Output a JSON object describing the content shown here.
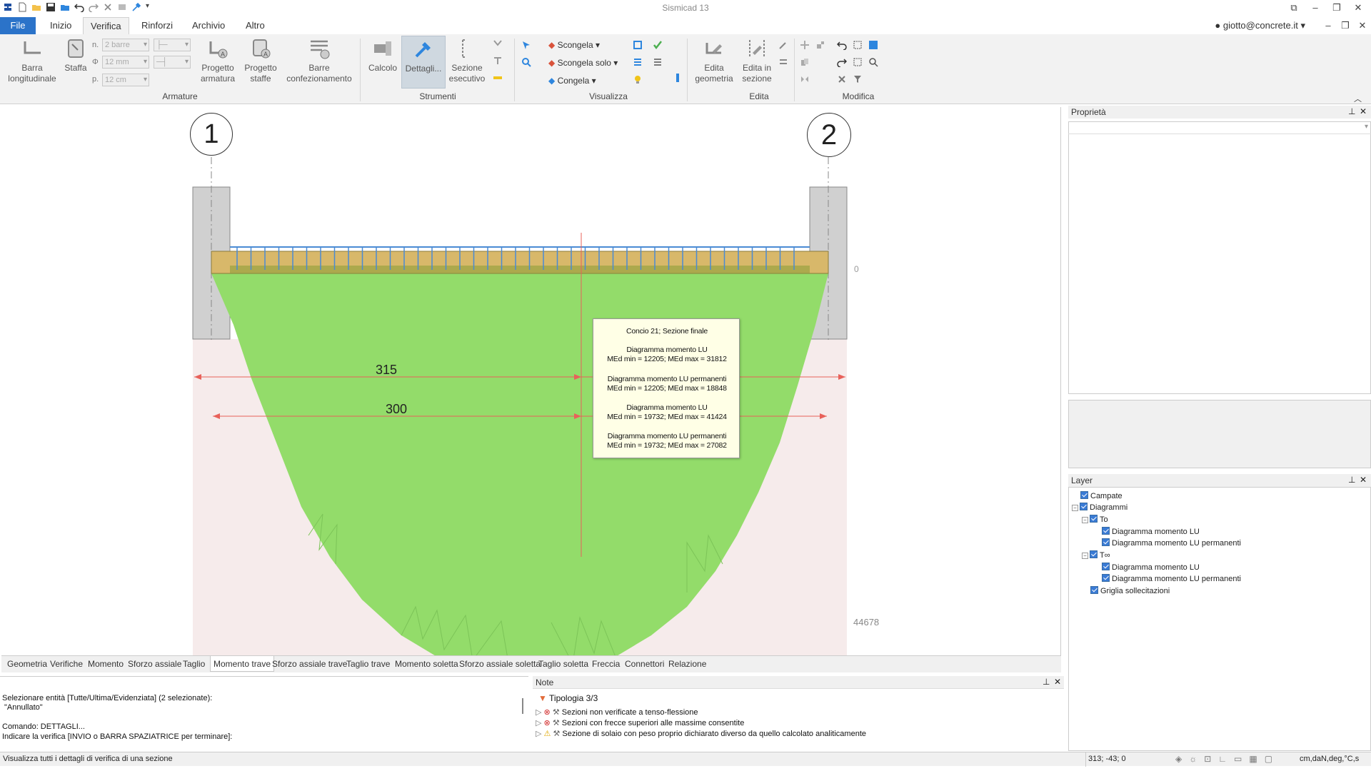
{
  "app": {
    "title": "Sismicad 13",
    "user": "giotto@concrete.it"
  },
  "ribbon_tabs": [
    "File",
    "Inizio",
    "Verifica",
    "Rinforzi",
    "Archivio",
    "Altro"
  ],
  "ribbon": {
    "armature": {
      "group": "Armature",
      "barra_line1": "Barra",
      "barra_line2": "longitudinale",
      "staffa": "Staffa",
      "n_label": "n.",
      "n_value": "2 barre",
      "phi_label": "Φ",
      "phi_value": "12 mm",
      "p_label": "p.",
      "p_value": "12 cm",
      "progetto_arm_1": "Progetto",
      "progetto_arm_2": "armatura",
      "progetto_staffe_1": "Progetto",
      "progetto_staffe_2": "staffe",
      "barre_conf_1": "Barre",
      "barre_conf_2": "confezionamento"
    },
    "strumenti": {
      "group": "Strumenti",
      "calcolo": "Calcolo",
      "dettagli": "Dettagli...",
      "sezione_1": "Sezione",
      "sezione_2": "esecutivo"
    },
    "visualizza": {
      "group": "Visualizza",
      "scongela": "Scongela",
      "scongela_solo": "Scongela solo",
      "congela": "Congela"
    },
    "edita": {
      "group": "Edita",
      "edita_geom_1": "Edita",
      "edita_geom_2": "geometria",
      "edita_sez_1": "Edita in",
      "edita_sez_2": "sezione"
    },
    "modifica": {
      "group": "Modifica"
    }
  },
  "drawing": {
    "axis1": "1",
    "axis2": "2",
    "zero_label": "0",
    "dim_315": "315",
    "dim_300": "300",
    "max_label": "44678",
    "tooltip": {
      "title": "Concio 21; Sezione finale",
      "b1_name": "Diagramma momento LU",
      "b1_vals": "MEd min = 12205; MEd max = 31812",
      "b2_name": "Diagramma momento LU permanenti",
      "b2_vals": "MEd min = 12205; MEd max = 18848",
      "b3_name": "Diagramma momento LU",
      "b3_vals": "MEd min = 19732; MEd max = 41424",
      "b4_name": "Diagramma momento LU permanenti",
      "b4_vals": "MEd min = 19732; MEd max = 27082"
    },
    "colors": {
      "diagram": "#93dc6a",
      "slab": "#d8b86a",
      "support": "#c8c8c8",
      "dim": "#e8615a"
    }
  },
  "panels": {
    "properties_title": "Proprietà",
    "layer_title": "Layer",
    "layers": {
      "campate": "Campate",
      "diagrammi": "Diagrammi",
      "to": "To",
      "to_lu": "Diagramma momento LU",
      "to_lup": "Diagramma momento LU permanenti",
      "tinf": "T∞",
      "tinf_lu": "Diagramma momento LU",
      "tinf_lup": "Diagramma momento LU permanenti",
      "griglia": "Griglia sollecitazioni"
    }
  },
  "bottom_tabs": [
    "Geometria",
    "Verifiche",
    "Momento",
    "Sforzo assiale",
    "Taglio",
    "Momento trave",
    "Sforzo assiale trave",
    "Taglio trave",
    "Momento soletta",
    "Sforzo assiale soletta",
    "Taglio soletta",
    "Freccia",
    "Connettori",
    "Relazione"
  ],
  "command": {
    "line1": "Selezionare entità [Tutte/Ultima/Evidenziata] (2 selezionate):",
    "line2": "\"Annullato\"",
    "line3": "Comando: DETTAGLI...",
    "line4": "Indicare la verifica [INVIO o BARRA SPAZIATRICE per terminare]:"
  },
  "notes": {
    "title": "Note",
    "filter": "Tipologia 3/3",
    "n1": "Sezioni non verificate a tenso-flessione",
    "n2": "Sezioni con frecce superiori alle massime consentite",
    "n3": "Sezione di solaio con peso proprio dichiarato diverso da quello calcolato analiticamente"
  },
  "status": {
    "text": "Visualizza tutti i dettagli di verifica di una sezione",
    "coords": "313; -43; 0",
    "units": "cm,daN,deg,°C,s"
  }
}
